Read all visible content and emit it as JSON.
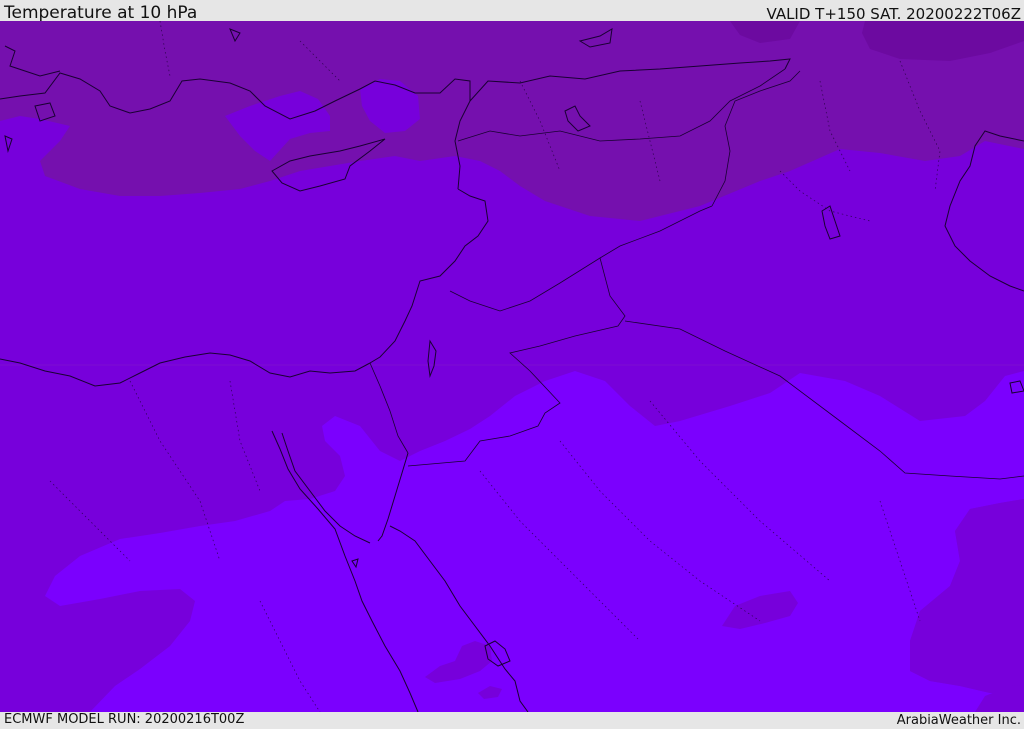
{
  "header": {
    "title": "Temperature at 10 hPa",
    "valid": "VALID T+150 SAT. 20200222T06Z"
  },
  "footer": {
    "model_run": "ECMWF MODEL RUN: 20200216T00Z",
    "credit": "ArabiaWeather Inc."
  },
  "colors": {
    "warm_band": "#7510ae",
    "mid_band": "#7700db",
    "cool_band": "#7b00fe",
    "darkest_band": "#6c0aa0",
    "border_line": "#1a0033",
    "bar_background": "#e6e6e6"
  }
}
